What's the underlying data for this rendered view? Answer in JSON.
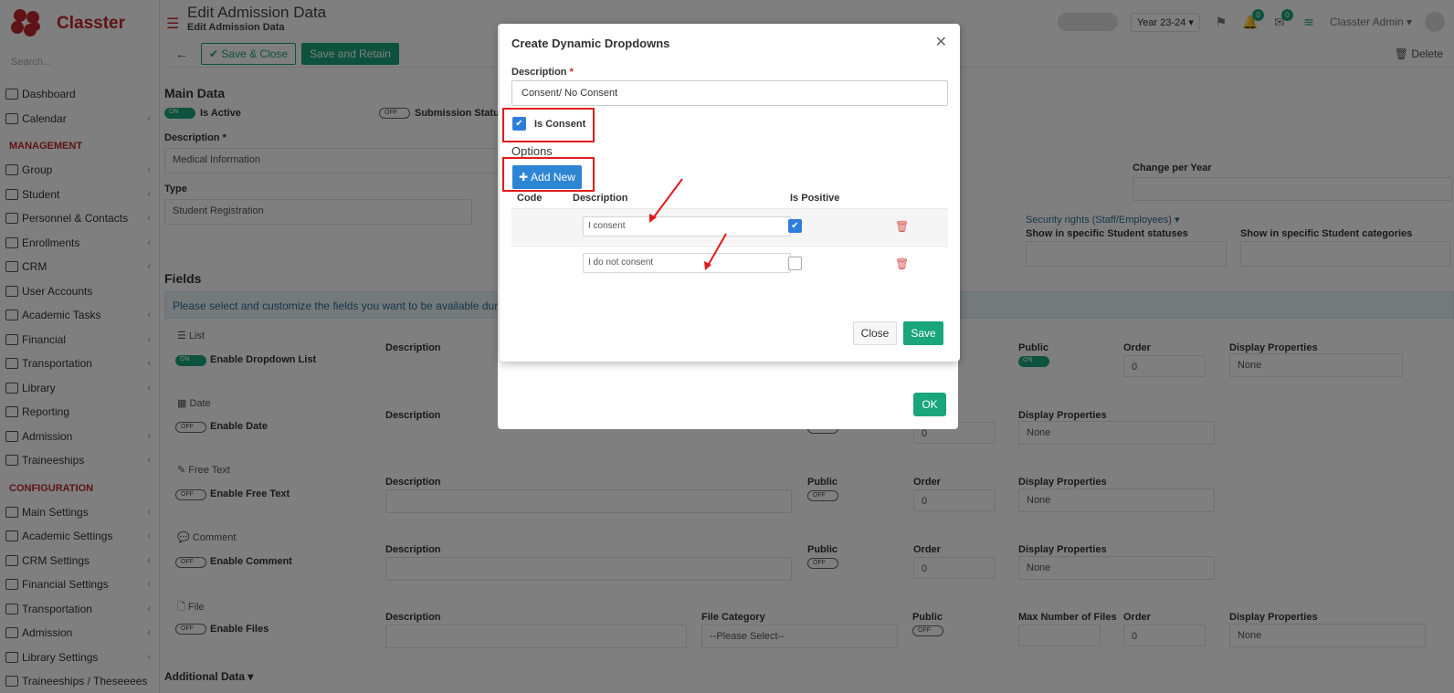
{
  "app": {
    "brand": "Classter",
    "search_placeholder": "Search..."
  },
  "sidebar": {
    "top_items": [
      {
        "label": "Dashboard",
        "icon": "monitor-icon"
      },
      {
        "label": "Calendar",
        "icon": "calendar-icon"
      }
    ],
    "management_title": "MANAGEMENT",
    "management_items": [
      {
        "label": "Group"
      },
      {
        "label": "Student"
      },
      {
        "label": "Personnel & Contacts"
      },
      {
        "label": "Enrollments"
      },
      {
        "label": "CRM"
      },
      {
        "label": "User Accounts"
      },
      {
        "label": "Academic Tasks"
      },
      {
        "label": "Financial"
      },
      {
        "label": "Transportation"
      },
      {
        "label": "Library"
      },
      {
        "label": "Reporting"
      },
      {
        "label": "Admission"
      },
      {
        "label": "Traineeships"
      }
    ],
    "configuration_title": "CONFIGURATION",
    "configuration_items": [
      {
        "label": "Main Settings"
      },
      {
        "label": "Academic Settings"
      },
      {
        "label": "CRM Settings"
      },
      {
        "label": "Financial Settings"
      },
      {
        "label": "Transportation"
      },
      {
        "label": "Admission"
      },
      {
        "label": "Library Settings"
      },
      {
        "label": "Traineeships / Theseeees"
      }
    ]
  },
  "header": {
    "title": "Edit Admission Data",
    "subtitle": "Edit Admission Data",
    "year": "Year 23-24",
    "notif_count": "0",
    "msg_count": "0",
    "user": "Classter Admin"
  },
  "toolbar": {
    "save_close": "Save & Close",
    "save_retain": "Save and Retain",
    "delete": "Delete"
  },
  "main": {
    "main_data": "Main Data",
    "is_active": "Is Active",
    "submission_status": "Submission Status",
    "description_label": "Description *",
    "description_value": "Medical Information",
    "type_label": "Type",
    "type_value": "Student Registration",
    "change_per_year": "Change per Year",
    "security_rights": "Security rights (Staff/Employees)",
    "show_statuses": "Show in specific Student statuses",
    "show_categories": "Show in specific Student categories",
    "fields": "Fields",
    "info": "Please select and customize the fields you want to be available during su",
    "rows": [
      {
        "icon": "List",
        "enable": "Enable Dropdown List",
        "toggle": "ON"
      },
      {
        "icon": "Date",
        "enable": "Enable Date",
        "toggle": "OFF"
      },
      {
        "icon": "Free Text",
        "enable": "Enable Free Text",
        "toggle": "OFF"
      },
      {
        "icon": "Comment",
        "enable": "Enable Comment",
        "toggle": "OFF"
      },
      {
        "icon": "File",
        "enable": "Enable Files",
        "toggle": "OFF"
      }
    ],
    "col_description": "Description",
    "col_public": "Public",
    "col_order": "Order",
    "col_display": "Display Properties",
    "col_file_category": "File Category",
    "col_max_files": "Max Number of Files",
    "order_value": "0",
    "display_value": "None",
    "file_category_value": "--Please Select--",
    "additional_data": "Additional Data"
  },
  "outer_modal": {
    "ok": "OK"
  },
  "modal": {
    "title": "Create Dynamic Dropdowns",
    "description_label": "Description",
    "required_mark": "*",
    "description_value": "Consent/ No Consent",
    "is_consent": "Is Consent",
    "options": "Options",
    "add_new": "Add New",
    "col_code": "Code",
    "col_description": "Description",
    "col_positive": "Is Positive",
    "option_rows": [
      {
        "description": "I consent",
        "positive": true
      },
      {
        "description": "I do not consent",
        "positive": false
      }
    ],
    "close": "Close",
    "save": "Save"
  },
  "colors": {
    "brand": "#c0262d",
    "accent": "#1aa57a",
    "primary": "#2d86d4",
    "highlight": "#e01b1b"
  }
}
